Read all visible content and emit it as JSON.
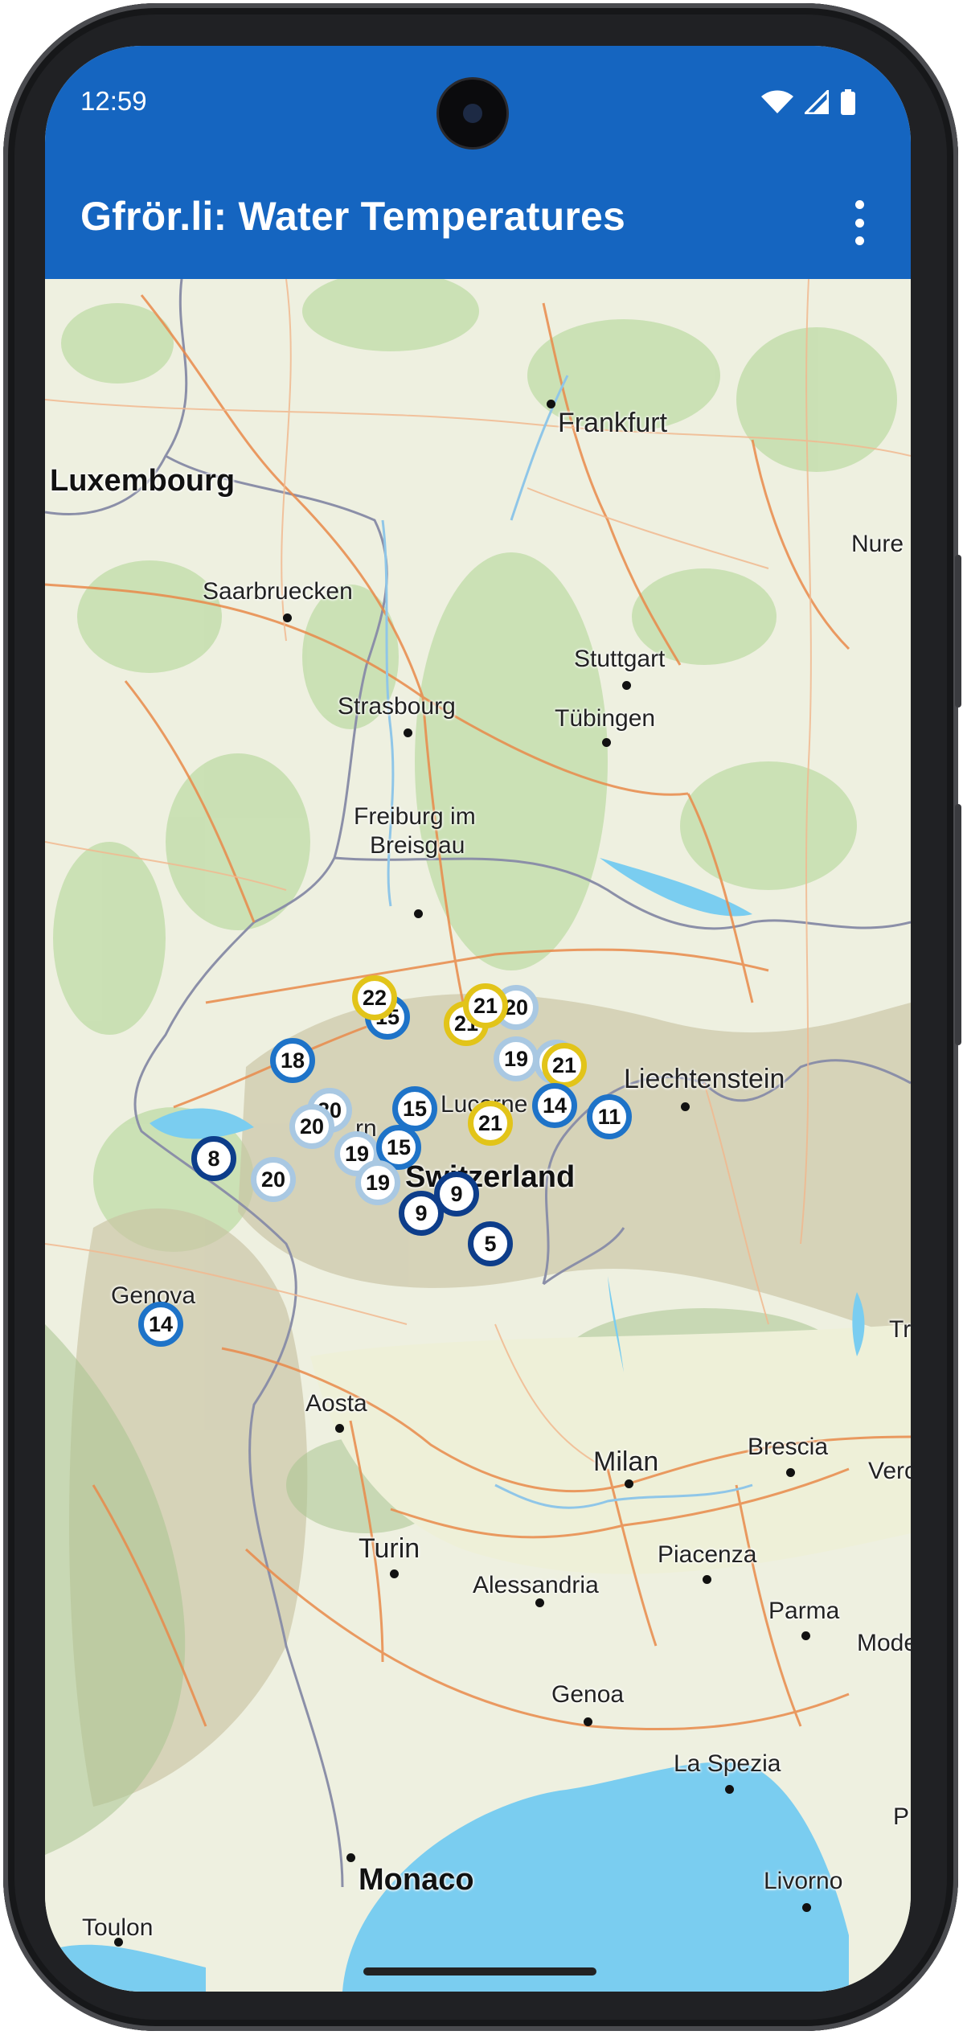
{
  "status_bar": {
    "time": "12:59"
  },
  "app_bar": {
    "title": "Gfrör.li: Water Temperatures",
    "menu_icon": "overflow-menu-icon"
  },
  "map": {
    "cities": {
      "frankfurt": "Frankfurt",
      "luxembourg": "Luxembourg",
      "nuremberg": "Nure",
      "saarbruecken": "Saarbruecken",
      "stuttgart": "Stuttgart",
      "strasbourg": "Strasbourg",
      "tubingen": "Tübingen",
      "freiburg_1": "Freiburg im",
      "freiburg_2": "Breisgau",
      "liechtenstein": "Liechtenstein",
      "switzerland": "Switzerland",
      "lucerne": "Lucerne",
      "bern": "rn",
      "genova": "Genova",
      "tr": "Tr",
      "aosta": "Aosta",
      "milan": "Milan",
      "brescia": "Brescia",
      "verona": "Vero",
      "turin": "Turin",
      "piacenza": "Piacenza",
      "alessandria": "Alessandria",
      "parma": "Parma",
      "modena": "Mode",
      "genoa": "Genoa",
      "la_spezia": "La Spezia",
      "p": "P",
      "monaco": "Monaco",
      "livorno": "Livorno",
      "toulon": "Toulon"
    },
    "markers": {
      "m1": "22",
      "m2": "15",
      "m3": "21",
      "m4": "20",
      "m5": "21",
      "m6": "19",
      "m7": "18",
      "m8": "20",
      "m9": "20",
      "m10": "15",
      "m11": "15",
      "m12": "19",
      "m13": "8",
      "m14": "20",
      "m15": "19",
      "m16": "9",
      "m17": "9",
      "m18": "21",
      "m19": "14",
      "m20": "11",
      "m21": "5",
      "m22": "14",
      "m23": "21",
      "m24": "2"
    }
  },
  "colors": {
    "app_bar": "#1565c0",
    "marker_blue": "#1e73c8",
    "marker_navy": "#0d3d8a",
    "marker_light": "#a9c8e2",
    "marker_yellow": "#e2c419",
    "sea": "#7acdf0"
  }
}
